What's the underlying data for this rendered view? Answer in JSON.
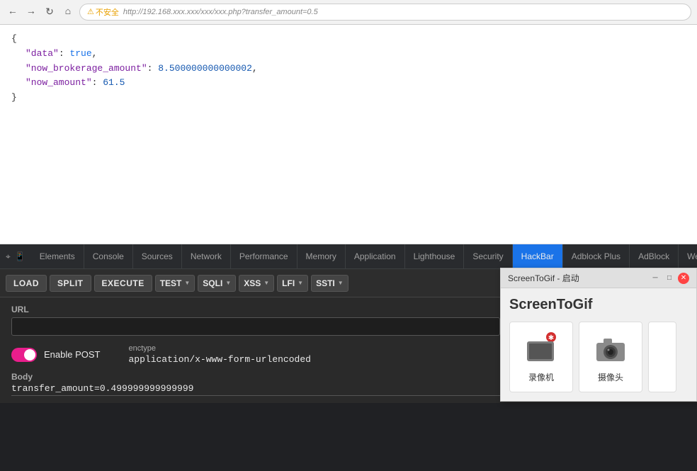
{
  "browser": {
    "security_warning": "不安全",
    "url": "                                                              "
  },
  "json_content": {
    "line1": "{",
    "data_key": "\"data\":",
    "data_value": "true,",
    "brokerage_key": "\"now_brokerage_amount\":",
    "brokerage_value": "8.500000000000002,",
    "amount_key": "\"now_amount\":",
    "amount_value": "61.5",
    "line_end": "}"
  },
  "devtools": {
    "tabs": [
      {
        "label": "Elements",
        "active": false
      },
      {
        "label": "Console",
        "active": false
      },
      {
        "label": "Sources",
        "active": false
      },
      {
        "label": "Network",
        "active": false
      },
      {
        "label": "Performance",
        "active": false
      },
      {
        "label": "Memory",
        "active": false
      },
      {
        "label": "Application",
        "active": false
      },
      {
        "label": "Lighthouse",
        "active": false
      },
      {
        "label": "Security",
        "active": false
      },
      {
        "label": "HackBar",
        "active": true
      },
      {
        "label": "Adblock Plus",
        "active": false
      },
      {
        "label": "AdBlock",
        "active": false
      },
      {
        "label": "We",
        "active": false
      }
    ]
  },
  "hackbar": {
    "buttons": [
      {
        "label": "LOAD"
      },
      {
        "label": "SPLIT"
      },
      {
        "label": "EXECUTE"
      },
      {
        "label": "TEST"
      },
      {
        "label": "SQLI"
      },
      {
        "label": "XSS"
      },
      {
        "label": "LFI"
      },
      {
        "label": "SSTI"
      }
    ],
    "url_label": "URL",
    "url_value": "",
    "enable_post_label": "Enable POST",
    "enctype_label": "enctype",
    "enctype_value": "application/x-www-form-urlencoded",
    "body_label": "Body",
    "body_value": "transfer_amount=0.499999999999999"
  },
  "screentogif": {
    "title": "ScreenToGif - 启动",
    "heading": "ScreenToGif",
    "options": [
      {
        "label": "录像机",
        "icon": "video"
      },
      {
        "label": "摄像头",
        "icon": "camera"
      }
    ]
  }
}
